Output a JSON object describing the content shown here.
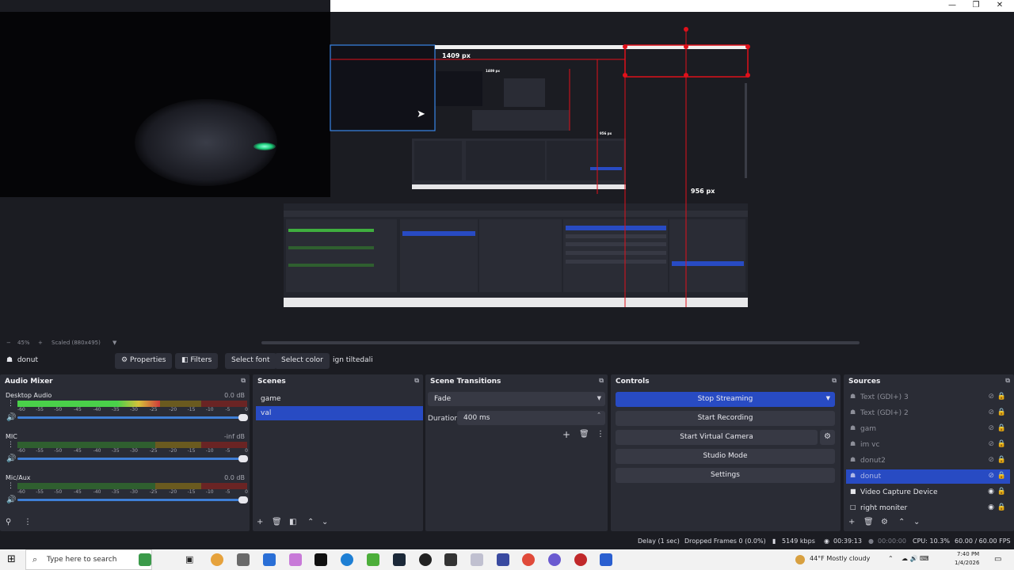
{
  "preview": {
    "label_width": "1409 px",
    "label_width_small": "1409 px",
    "label_height": "956 px",
    "label_height_small": "956 px"
  },
  "scalebar": {
    "zoom": "45%",
    "scaled": "Scaled (880x495)"
  },
  "source_toolbar": {
    "source_name": "donut",
    "properties": "Properties",
    "filters": "Filters",
    "select_font": "Select font",
    "select_color": "Select color",
    "text_value": "ign tiltedali"
  },
  "audio_mixer": {
    "title": "Audio Mixer",
    "ticks": [
      "-60",
      "-55",
      "-50",
      "-45",
      "-40",
      "-35",
      "-30",
      "-25",
      "-20",
      "-15",
      "-10",
      "-5",
      "0"
    ],
    "channels": [
      {
        "name": "Desktop Audio",
        "db": "0.0 dB",
        "level": 0.62
      },
      {
        "name": "MIC",
        "db": "-inf dB",
        "level": 0.0
      },
      {
        "name": "Mic/Aux",
        "db": "0.0 dB",
        "level": 0.0
      }
    ]
  },
  "scenes": {
    "title": "Scenes",
    "items": [
      "game",
      "val"
    ],
    "selected": "val"
  },
  "transitions": {
    "title": "Scene Transitions",
    "type": "Fade",
    "duration_label": "Duration",
    "duration_value": "400 ms"
  },
  "controls": {
    "title": "Controls",
    "stop_streaming": "Stop Streaming",
    "start_recording": "Start Recording",
    "start_virtual_camera": "Start Virtual Camera",
    "studio_mode": "Studio Mode",
    "settings": "Settings"
  },
  "sources": {
    "title": "Sources",
    "items": [
      {
        "name": "Text (GDI+) 3",
        "visible": false
      },
      {
        "name": "Text (GDI+) 2",
        "visible": false
      },
      {
        "name": "gam",
        "visible": false
      },
      {
        "name": "im vc",
        "visible": false
      },
      {
        "name": "donut2",
        "visible": false
      },
      {
        "name": "donut",
        "visible": false
      },
      {
        "name": "Video Capture Device",
        "visible": true
      },
      {
        "name": "right moniter",
        "visible": true
      }
    ],
    "selected": "donut"
  },
  "status": {
    "delay": "Delay (1 sec)",
    "dropped_frames": "Dropped Frames 0 (0.0%)",
    "bitrate": "5149 kbps",
    "stream_time": "00:39:13",
    "record_time": "00:00:00",
    "cpu": "CPU: 10.3%",
    "fps": "60.00 / 60.00 FPS"
  },
  "taskbar": {
    "search_placeholder": "Type here to search",
    "weather": "44°F  Mostly cloudy",
    "time": "7:40 PM",
    "date": "1/4/2026"
  },
  "colors": {
    "accent": "#284bc3",
    "dock_bg": "#2a2c35",
    "app_bg": "#1b1c22",
    "guide_red": "#e0101a"
  }
}
